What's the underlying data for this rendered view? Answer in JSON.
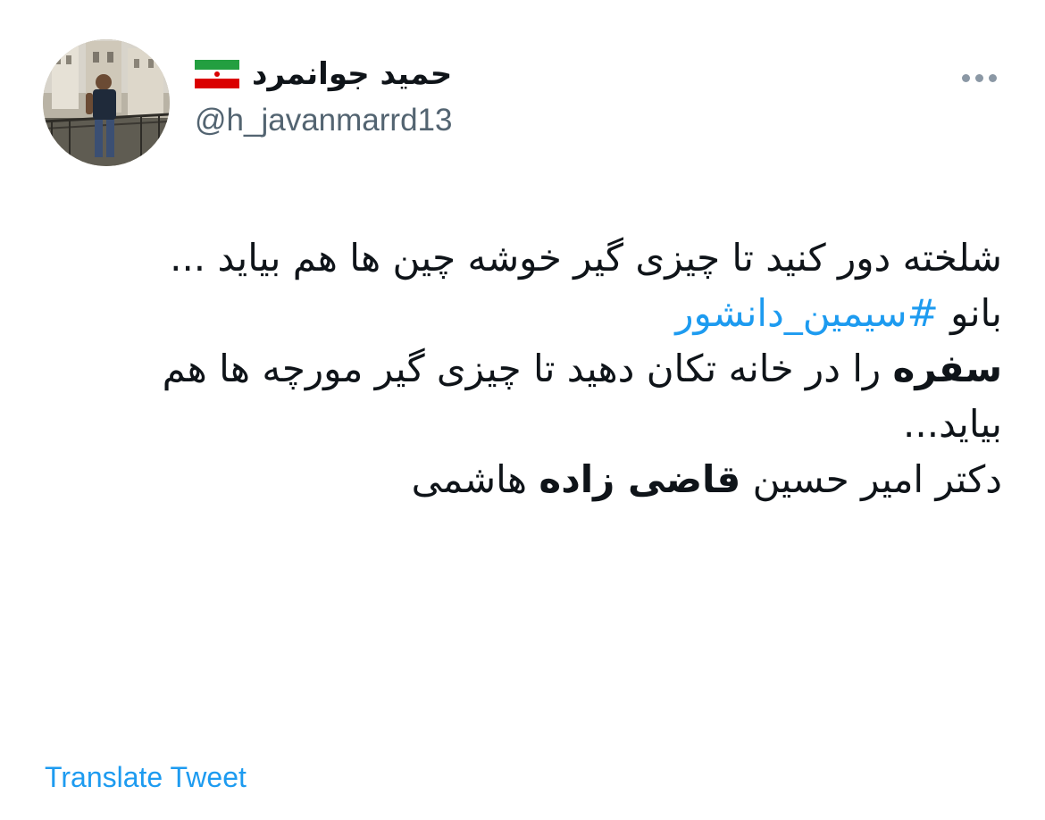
{
  "author": {
    "display_name": "حمید جوانمرد",
    "flag_icon": "iran-flag-icon",
    "handle": "@h_javanmarrd13",
    "avatar_icon": "profile-photo"
  },
  "tweet": {
    "line1": "شلخته دور کنید تا چیزی گیر خوشه چین ها هم بیاید ...",
    "line2_prefix": "بانو ",
    "hashtag": "#سیمین_دانشور",
    "line3_bold": "سفره",
    "line3_rest": " را در خانه تکان دهید تا چیزی گیر مورچه ها هم بیاید...",
    "line4_prefix": "دکتر امیر حسین ",
    "line4_bold": "قاضی زاده",
    "line4_suffix": " هاشمی"
  },
  "actions": {
    "more_icon": "more-dots-icon",
    "translate_label": "Translate Tweet"
  },
  "colors": {
    "link": "#1d9bf0",
    "secondary_text": "#536471",
    "primary_text": "#0f1419"
  }
}
